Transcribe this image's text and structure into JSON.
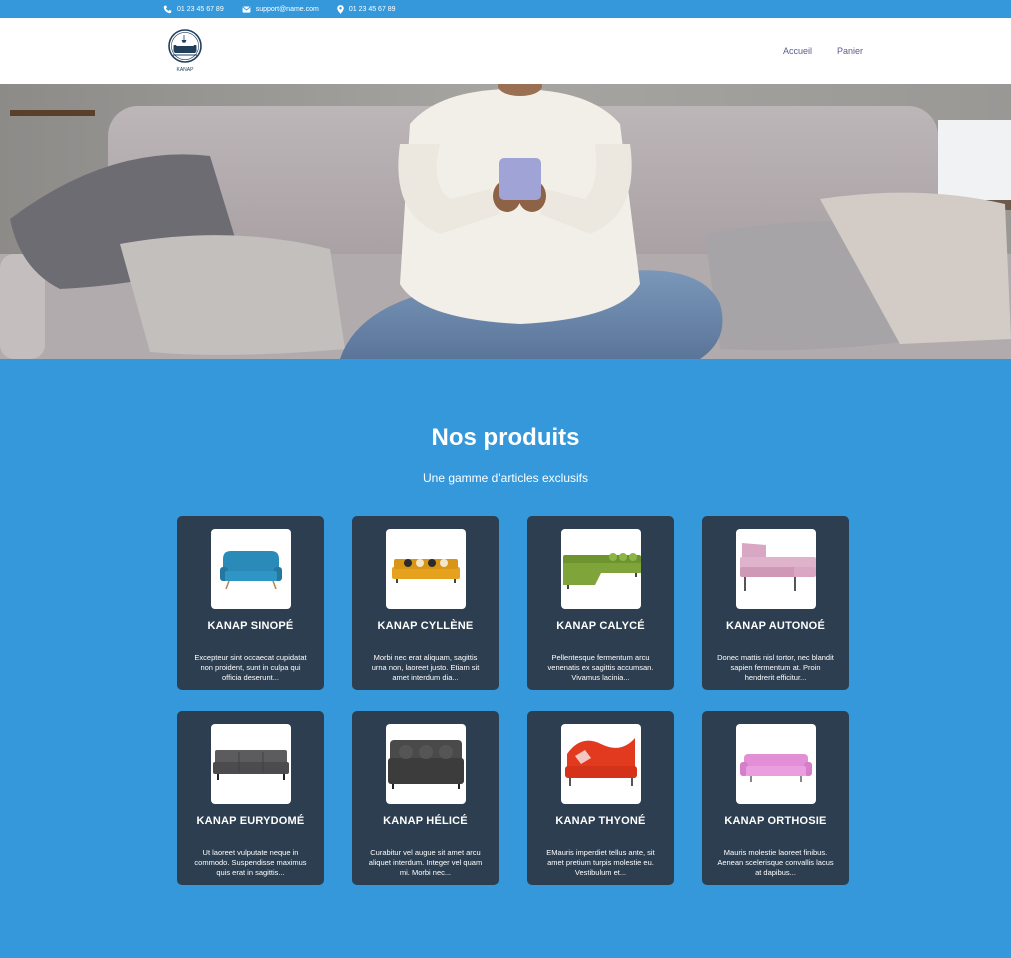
{
  "topbar": {
    "phone": "01 23 45 67 89",
    "email": "support@name.com",
    "address": "01 23 45 67 89",
    "icons": [
      "phone-icon",
      "mail-icon",
      "location-pin-icon"
    ]
  },
  "header": {
    "logo_text": "KANAP",
    "nav": [
      {
        "label": "Accueil"
      },
      {
        "label": "Panier"
      }
    ]
  },
  "colors": {
    "brand_blue": "#3498db",
    "card_bg": "#2c3e50",
    "nav_text": "#5b5b8e"
  },
  "products_section": {
    "title": "Nos produits",
    "subtitle": "Une gamme d'articles exclusifs"
  },
  "products": [
    {
      "name": "KANAP SINOPÉ",
      "description": "Excepteur sint occaecat cupidatat non proident, sunt in culpa qui officia deserunt...",
      "color": "#2a8ab8"
    },
    {
      "name": "KANAP CYLLÈNE",
      "description": "Morbi nec erat aliquam, sagittis urna non, laoreet justo. Etiam sit amet interdum dia...",
      "color": "#e6a21d"
    },
    {
      "name": "KANAP CALYCÉ",
      "description": "Pellentesque fermentum arcu venenatis ex sagittis accumsan. Vivamus lacinia...",
      "color": "#7ea43a"
    },
    {
      "name": "KANAP AUTONOÉ",
      "description": "Donec mattis nisl tortor, nec blandit sapien fermentum at. Proin hendrerit efficitur...",
      "color": "#d9a7c3"
    },
    {
      "name": "KANAP EURYDOMÉ",
      "description": "Ut laoreet vulputate neque in commodo. Suspendisse maximus quis erat in sagittis...",
      "color": "#5c5c5e"
    },
    {
      "name": "KANAP HÉLICÉ",
      "description": "Curabitur vel augue sit amet arcu aliquet interdum. Integer vel quam mi. Morbi nec...",
      "color": "#4a4a4a"
    },
    {
      "name": "KANAP THYONÉ",
      "description": "EMauris imperdiet tellus ante, sit amet pretium turpis molestie eu. Vestibulum et...",
      "color": "#e23a1f"
    },
    {
      "name": "KANAP ORTHOSIE",
      "description": "Mauris molestie laoreet finibus. Aenean scelerisque convallis lacus at dapibus...",
      "color": "#e38fd8"
    }
  ]
}
